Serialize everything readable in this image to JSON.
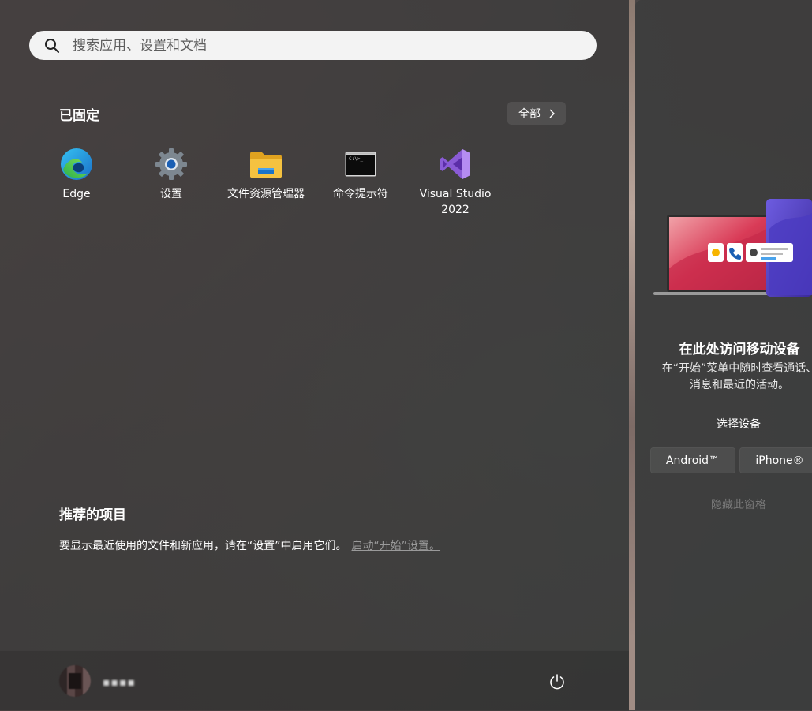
{
  "search": {
    "placeholder": "搜索应用、设置和文档"
  },
  "pinned": {
    "title": "已固定",
    "all_button": "全部",
    "apps": [
      {
        "label": "Edge",
        "icon": "edge-icon"
      },
      {
        "label": "设置",
        "icon": "settings-gear-icon"
      },
      {
        "label": "文件资源管理器",
        "icon": "folder-icon"
      },
      {
        "label": "命令提示符",
        "icon": "terminal-icon"
      },
      {
        "label": "Visual Studio 2022",
        "icon": "visual-studio-icon"
      }
    ]
  },
  "recommended": {
    "title": "推荐的项目",
    "text": "要显示最近使用的文件和新应用，请在“设置”中启用它们。",
    "link": "启动“开始”设置。"
  },
  "footer": {
    "user_name": "▪▪▪▪"
  },
  "side_panel": {
    "title": "在此处访问移动设备",
    "description_line1": "在“开始”菜单中随时查看通话、",
    "description_line2": "消息和最近的活动。",
    "choose_label": "选择设备",
    "android_button": "Android™",
    "iphone_button": "iPhone®",
    "hide_label": "隐藏此窗格"
  },
  "colors": {
    "accent_blue": "#1a5fb4",
    "folder_yellow": "#f5c240",
    "vs_purple": "#8a5bd6"
  }
}
